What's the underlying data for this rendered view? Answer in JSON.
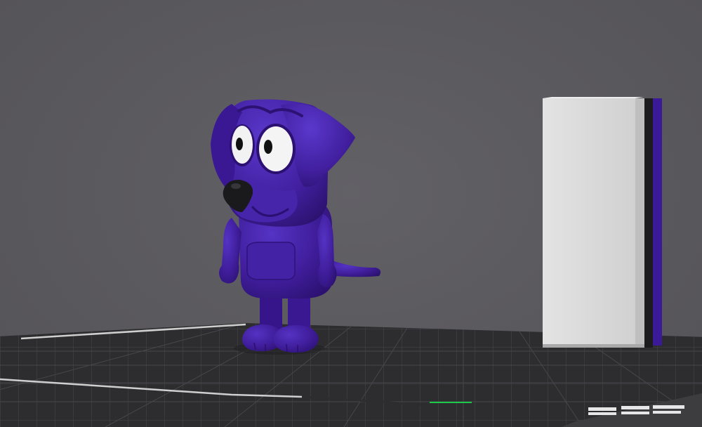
{
  "viewport": {
    "background_color": "#5a595d",
    "model_color": "#3f1d9a",
    "bed_color": "#2d2d30",
    "wipe_tower_color": "#d9d9d9"
  },
  "scene": {
    "objects": [
      {
        "name": "dog-figurine",
        "type": "model"
      },
      {
        "name": "wipe-tower",
        "type": "prime-tower"
      }
    ],
    "origin_marker": {
      "x_axis_color": "#1ec94a"
    }
  }
}
